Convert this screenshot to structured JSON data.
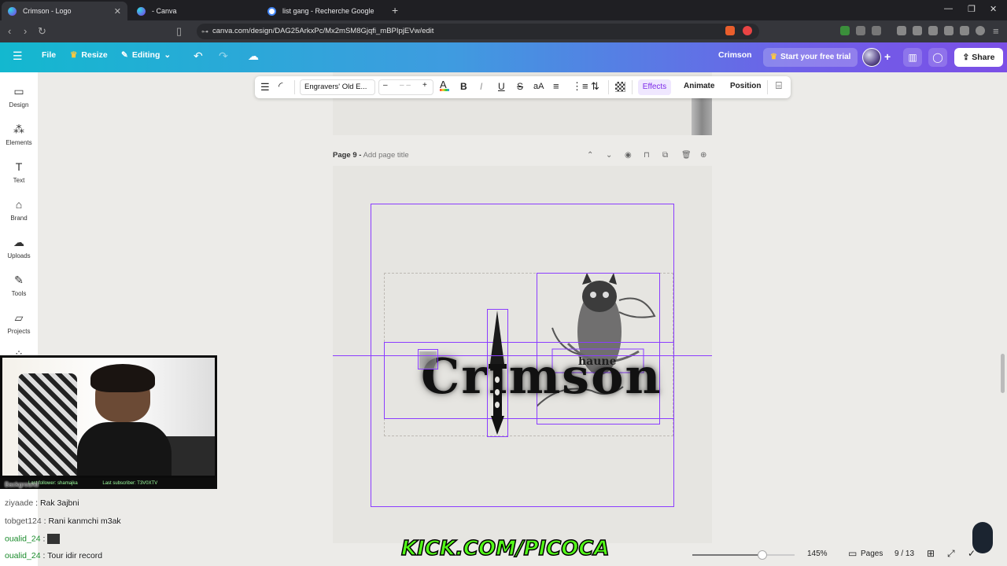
{
  "browser": {
    "tabs": [
      {
        "title": "Crimson - Logo",
        "icon": "canva-icon"
      },
      {
        "title": "- Canva",
        "icon": "canva-icon"
      },
      {
        "title": "list gang - Recherche Google",
        "icon": "google-icon"
      }
    ],
    "url": "canva.com/design/DAG25ArkxPc/Mx2mSM8Gjqfi_mBPIpjEVw/edit"
  },
  "header": {
    "file": "File",
    "resize": "Resize",
    "editing": "Editing",
    "design_name": "Crimson",
    "trial": "Start your free trial",
    "share": "Share"
  },
  "toolbar": {
    "font": "Engravers' Old E...",
    "minus": "–",
    "size": "– –",
    "plus": "+",
    "bold": "B",
    "italic": "I",
    "underline": "U",
    "strike": "S",
    "case": "aA",
    "effects": "Effects",
    "animate": "Animate",
    "position": "Position"
  },
  "rail": {
    "items": [
      {
        "label": "Design",
        "icon": "design-icon"
      },
      {
        "label": "Elements",
        "icon": "elements-icon"
      },
      {
        "label": "Text",
        "icon": "text-icon"
      },
      {
        "label": "Brand",
        "icon": "brand-icon"
      },
      {
        "label": "Uploads",
        "icon": "uploads-icon"
      },
      {
        "label": "Tools",
        "icon": "tools-icon"
      },
      {
        "label": "Projects",
        "icon": "projects-icon"
      }
    ]
  },
  "canvas": {
    "page_label": "Page 9 -",
    "page_title_placeholder": "Add page title",
    "logo_text": "Crimson",
    "owl_text": "haune"
  },
  "bottom": {
    "zoom": "145%",
    "pages": "Pages",
    "page_count": "9 / 13",
    "zoom_level": 0.68
  },
  "stream": {
    "last_follower": "Last follower: shamajka",
    "last_subscriber": "Last subscriber: T3V0XTV",
    "chat": [
      {
        "user": "tobg",
        "text": ""
      },
      {
        "user": "ziyaade",
        "text": ": Rak 3ajbni"
      },
      {
        "user": "tobget124",
        "text": ": Rani kanmchi m3ak"
      },
      {
        "user": "oualid_24",
        "text": ":"
      },
      {
        "user": "oualid_24",
        "text": ": Tour idir record"
      }
    ],
    "background_label": "Background",
    "kick": "KICK.COM/PICOCA"
  },
  "colors": {
    "accent": "#8b3dff",
    "header_start": "#13b8cf",
    "header_end": "#7b4fe6",
    "kick_green": "#53fc18"
  }
}
